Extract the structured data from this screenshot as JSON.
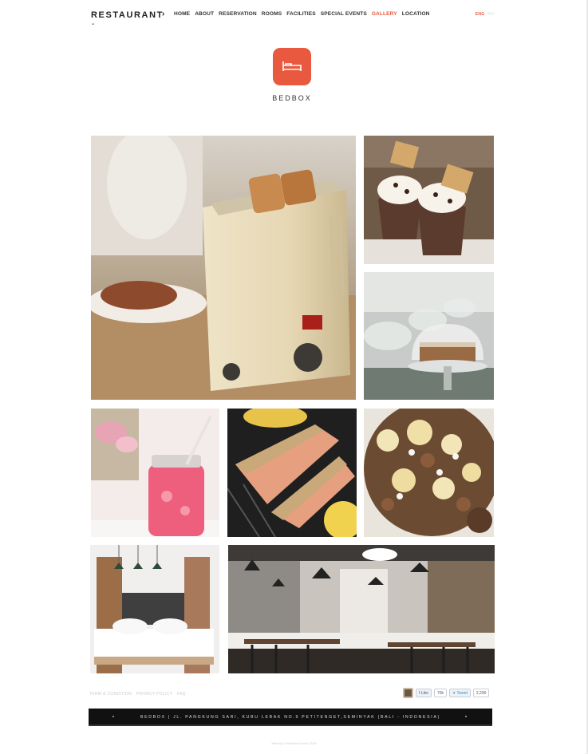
{
  "header": {
    "brand": "RESTAURANT",
    "brand_dash": "-",
    "nav": [
      "HOME",
      "ABOUT",
      "RESERVATION",
      "ROOMS",
      "FACILITIES",
      "SPECIAL EVENTS",
      "GALLERY",
      "LOCATION"
    ],
    "active_nav": "GALLERY",
    "lang_active": "ENG",
    "lang_other": "IND"
  },
  "logo": {
    "text": "BEDBOX",
    "icon": "bed-icon",
    "color": "#e9593f"
  },
  "gallery": {
    "photos": [
      {
        "name": "photo-toaster",
        "depicts": "toaster with toast"
      },
      {
        "name": "photo-milkshakes",
        "depicts": "chocolate milkshakes"
      },
      {
        "name": "photo-cake-stands",
        "depicts": "cake stands buffet"
      },
      {
        "name": "photo-pink-drink",
        "depicts": "pink drink in jar"
      },
      {
        "name": "photo-grilled-salmon",
        "depicts": "grilled salmon"
      },
      {
        "name": "photo-cauliflower-salad",
        "depicts": "cauliflower salad"
      },
      {
        "name": "photo-bedroom",
        "depicts": "hotel bedroom"
      },
      {
        "name": "photo-restaurant-interior",
        "depicts": "restaurant interior"
      }
    ]
  },
  "footer": {
    "links": [
      "TERM & CONDITION",
      "PRIVACY POLICY",
      "FAQ"
    ],
    "fb_like": "Like",
    "fb_count": "70k",
    "tweet": "Tweet",
    "tweet_count": "2,290",
    "address": "BEDBOX  |  JL. PANGKUNG SARI, KUBU LEBAK NO.9 PETITENGET,SEMINYAK (BALI - INDONESIA)",
    "copyright": "Web by H Whatnot Studio 2015"
  }
}
